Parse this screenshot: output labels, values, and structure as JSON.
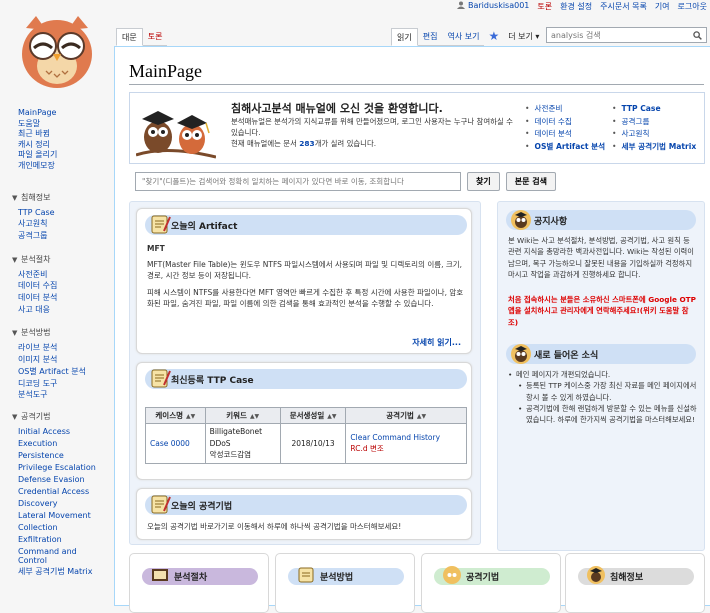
{
  "personal": {
    "username": "Bariduskisa001",
    "links": [
      "토론",
      "환경 설정",
      "주시문서 목록",
      "기여",
      "로그아웃"
    ]
  },
  "sidebar": {
    "main_links": [
      "MainPage",
      "도움말",
      "최근 바뀜",
      "캐시 정리",
      "파일 올리기",
      "개인메모장"
    ],
    "sections": [
      {
        "title": "침해정보",
        "items": [
          "TTP Case",
          "사고원칙",
          "공격그룹"
        ]
      },
      {
        "title": "분석절차",
        "items": [
          "사전준비",
          "데이터 수집",
          "데이터 분석",
          "사고 대응"
        ]
      },
      {
        "title": "분석방법",
        "items": [
          "라이브 분석",
          "이미지 분석",
          "OS별 Artifact 분석",
          "디코딩 도구",
          "분석도구"
        ]
      },
      {
        "title": "공격기법",
        "items": [
          "Initial Access",
          "Execution",
          "Persistence",
          "Privilege Escalation",
          "Defense Evasion",
          "Credential Access",
          "Discovery",
          "Lateral Movement",
          "Collection",
          "Exfiltration",
          "Command and Control",
          "세부 공격기법 Matrix"
        ]
      }
    ]
  },
  "tabs": {
    "left": [
      "대문",
      "토론"
    ],
    "right": [
      "읽기",
      "편집",
      "역사 보기"
    ],
    "more": "더 보기",
    "search_placeholder": "analysis 검색"
  },
  "page": {
    "title": "MainPage",
    "welcome": {
      "title": "침해사고분석 매뉴얼에 오신 것을 환영합니다.",
      "text": "분석매뉴얼은 분석가의 지식교류를 위해 만들어졌으며, 로그인 사용자는 누구나 참여하실 수 있습니다.",
      "count_prefix": "현재 매뉴얼에는 문서 ",
      "count": "283",
      "count_suffix": "개가 실려 있습니다.",
      "links_col1": [
        "사전준비",
        "데이터 수집",
        "데이터 분석",
        "OS별 Artifact 분석"
      ],
      "links_col2": [
        "TTP Case",
        "공격그룹",
        "사고원칙",
        "세부 공격기법 Matrix"
      ]
    },
    "search": {
      "placeholder": "\"찾기\"(디폴트)는 검색어와 정확히 일치하는 페이지가 있다면 바로 이동, 조회합니다",
      "go_label": "찾기",
      "fulltext_label": "본문 검색"
    },
    "artifact": {
      "heading": "오늘의 Artifact",
      "subtitle": "MFT",
      "para1": "MFT(Master File Table)는 윈도우 NTFS 파일시스템에서 사용되며 파일 및 디렉토리의 이름, 크기, 경로, 시간 정보 등이 저장됩니다.",
      "para2": "피해 시스템이 NTFS를 사용한다면 MFT 영역만 빠르게 수집한 후 특정 시간에 사용한 파일이나, 암호화된 파일, 숨겨진 파일, 파일 이름에 의한 검색을 통해 효과적인 분석을 수행할 수 있습니다.",
      "more": "자세히 읽기..."
    },
    "ttp": {
      "heading": "최신등록 TTP Case",
      "columns": [
        "케이스명",
        "키워드",
        "문서생성일",
        "공격기법"
      ],
      "row": {
        "case": "Case 0000",
        "keywords": [
          "BilligateBonet",
          "DDoS",
          "악성코드감염"
        ],
        "date": "2018/10/13",
        "technique1": "Clear Command History",
        "technique2": "RC.d 변조"
      }
    },
    "technique": {
      "heading": "오늘의 공격기법",
      "text": "오늘의 공격기법 바로가기로 이동해서 하루에 하나씩 공격기법을 마스터해보세요!"
    },
    "notice": {
      "heading": "공지사항",
      "text": "본 Wiki는 사고 분석절차, 분석방법, 공격기법, 사고 원칙 등 관련 지식을 총망라한 백과사전입니다. Wiki는 작성된 이력이 남으며, 복구 가능하오니 잘못된 내용을 기입하실까 걱정하지 마시고 작업을 과감하게 진행하세요 합니다.",
      "warning": "처음 접속하시는 분들은 소유하신 스마트폰에 Google OTP 앱을 설치하시고 관리자에게 연락해주세요!(위키 도움말 참조)"
    },
    "news": {
      "heading": "새로 들어온 소식",
      "items": [
        "메인 페이지가 개편되었습니다.",
        "등록된 TTP 케이스중 가장 최신 자료를 메인 페이지에서 항시 볼 수 있게 하였습니다.",
        "공격기법에 한해 랜덤하게 방문할 수 있는 메뉴를 신설하였습니다. 하루에 한가지씩 공격기법을 마스터해보세요!"
      ]
    },
    "bottom": [
      "분석절차",
      "분석방법",
      "공격기법",
      "침해정보"
    ]
  },
  "colors": {
    "link": "#0645ad",
    "header_blue": "#cfe0f5",
    "bottom_purple": "#c9b8dd",
    "bottom_blue": "#cfe0f5",
    "bottom_green": "#cfecd0",
    "bottom_gray": "#dcdcdc",
    "warning": "#dd0000"
  }
}
